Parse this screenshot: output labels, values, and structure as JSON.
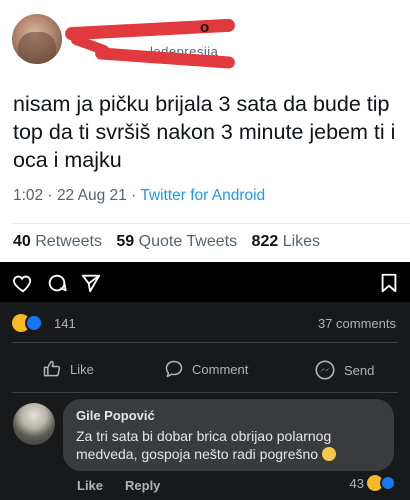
{
  "tweet": {
    "name_fragment": "o",
    "handle_fragment": "ledepresija",
    "text": "nisam ja pičku brijala 3 sata da bude tip top da ti svršiš nakon 3 minute jebem ti i oca i majku",
    "time": "1:02 · 22 Aug 21 · ",
    "source": "Twitter for Android",
    "stats": {
      "retweets_count": "40",
      "retweets_label": "Retweets",
      "quotes_count": "59",
      "quotes_label": "Quote Tweets",
      "likes_count": "822",
      "likes_label": "Likes"
    }
  },
  "instagram_bar": {
    "icons": [
      "heart-icon",
      "comment-icon",
      "send-icon",
      "bookmark-icon"
    ]
  },
  "facebook": {
    "reactions_count": "141",
    "comments_count": "37 comments",
    "actions": {
      "like": "Like",
      "comment": "Comment",
      "send": "Send"
    },
    "comment": {
      "author": "Gile Popović",
      "text": "Za tri sata bi dobar brica obrijao polarnog medveda, gospoja nešto radi pogrešno",
      "like_label": "Like",
      "reply_label": "Reply",
      "reactions_count": "43"
    }
  },
  "colors": {
    "redaction": "#e03a3e",
    "twitter_blue": "#1d9bf0",
    "fb_bg": "#18191a",
    "bubble": "#3a3b3c"
  }
}
